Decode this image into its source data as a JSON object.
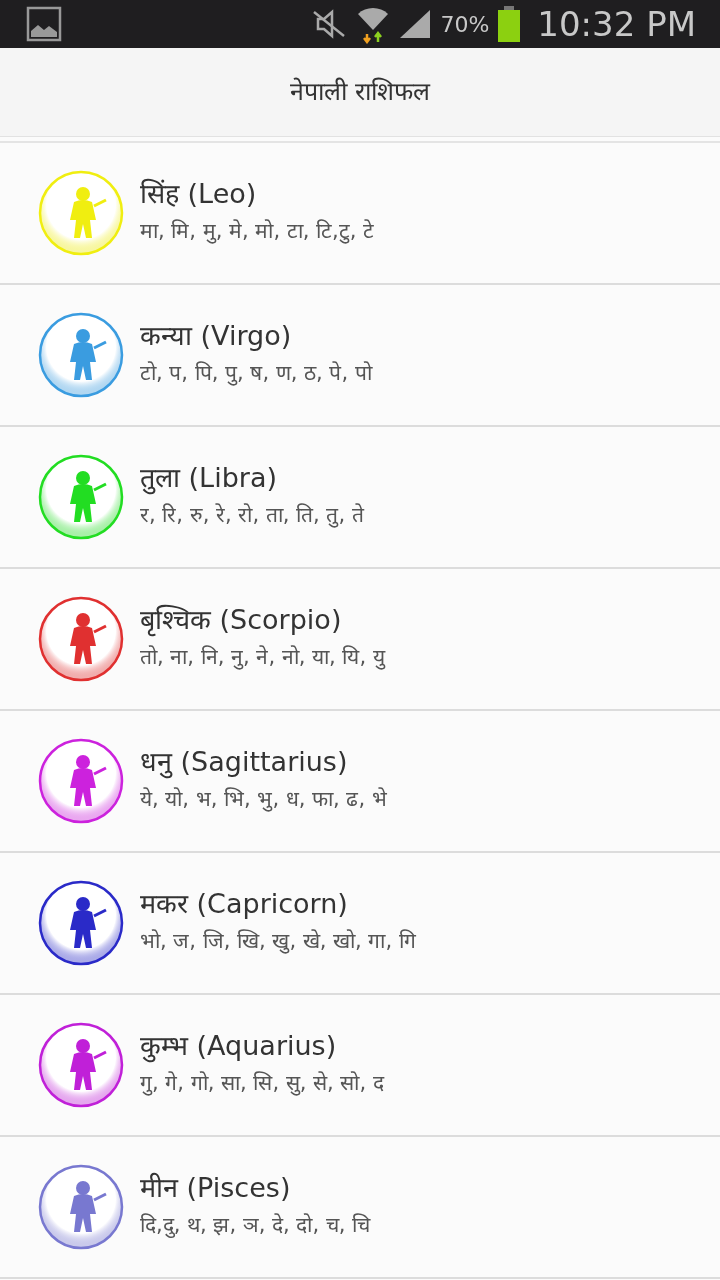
{
  "status_bar": {
    "battery": "70%",
    "time": "10:32 PM"
  },
  "header": {
    "title": "नेपाली राशिफल"
  },
  "signs": [
    {
      "title": "सिंह (Leo)",
      "letters": "मा, मि, मु, मे, मो, टा, टि,टु, टे",
      "color": "#f0ee10"
    },
    {
      "title": "कन्या (Virgo)",
      "letters": "टो, प, पि, पु, ष, ण, ठ, पे, पो",
      "color": "#3a9ce0"
    },
    {
      "title": "तुला (Libra)",
      "letters": "र, रि, रु, रे, रो, ता, ति, तु, ते",
      "color": "#22dd22"
    },
    {
      "title": "बृश्चिक (Scorpio)",
      "letters": "तो, ना, नि, नु, ने, नो, या, यि, यु",
      "color": "#e03030"
    },
    {
      "title": "धनु (Sagittarius)",
      "letters": "ये, यो, भ, भि, भु, ध, फा, ढ, भे",
      "color": "#cc22dd"
    },
    {
      "title": "मकर (Capricorn)",
      "letters": "भो, ज, जि, खि, खु, खे, खो, गा, गि",
      "color": "#2a2ac8"
    },
    {
      "title": "कुम्भ (Aquarius)",
      "letters": "गु, गे, गो, सा, सि, सु, से, सो, द",
      "color": "#c020d8"
    },
    {
      "title": "मीन (Pisces)",
      "letters": "दि,दु, थ, झ, ञ, दे, दो, च, चि",
      "color": "#7878d0"
    }
  ]
}
